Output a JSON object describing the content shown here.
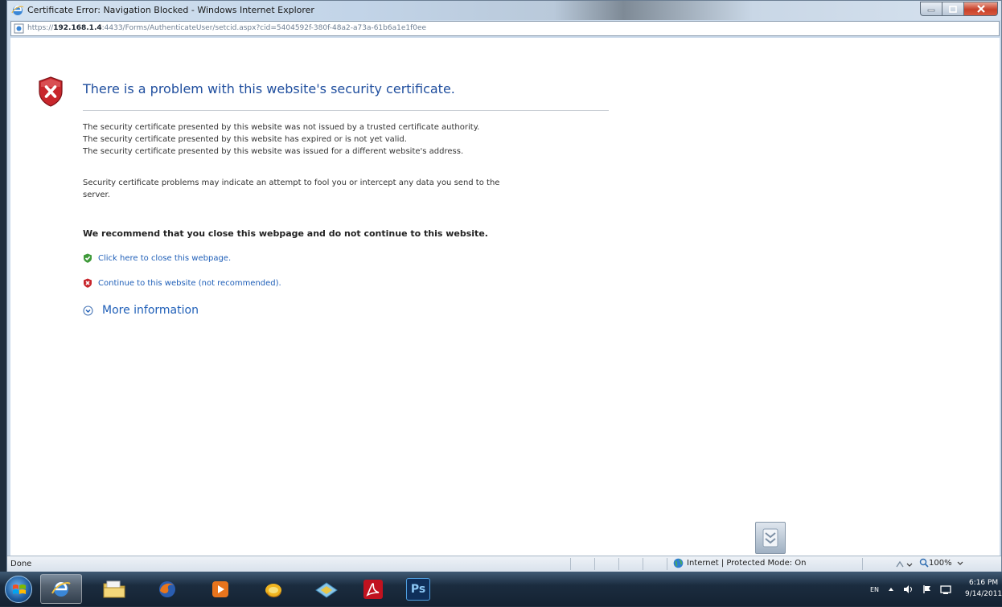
{
  "window": {
    "title": "Certificate Error: Navigation Blocked - Windows Internet Explorer"
  },
  "address": {
    "prefix": "https://",
    "host": "192.168.1.4",
    "rest": ":4433/Forms/AuthenticateUser/setcid.aspx?cid=5404592f-380f-48a2-a73a-61b6a1e1f0ee"
  },
  "page": {
    "heading": "There is a problem with this website's security certificate.",
    "reasons": [
      "The security certificate presented by this website was not issued by a trusted certificate authority.",
      "The security certificate presented by this website has expired or is not yet valid.",
      "The security certificate presented by this website was issued for a different website's address."
    ],
    "warning_line1": "Security certificate problems may indicate an attempt to fool you or intercept any data you send to the",
    "warning_line2": "server.",
    "recommend": "We recommend that you close this webpage and do not continue to this website.",
    "close_link": "Click here to close this webpage.",
    "continue_link": "Continue to this website (not recommended).",
    "more_info": "More information"
  },
  "status": {
    "left": "Done",
    "zone": "Internet | Protected Mode: On",
    "zoom": "100%"
  },
  "tray": {
    "lang": "EN",
    "time": "6:16 PM",
    "date": "9/14/2011"
  },
  "taskbar": {
    "photoshop_label": "Ps"
  },
  "colors": {
    "link": "#1f5fb8",
    "heading": "#1f4e9e",
    "error_red": "#c8262c",
    "safe_green": "#3f9a3a"
  }
}
